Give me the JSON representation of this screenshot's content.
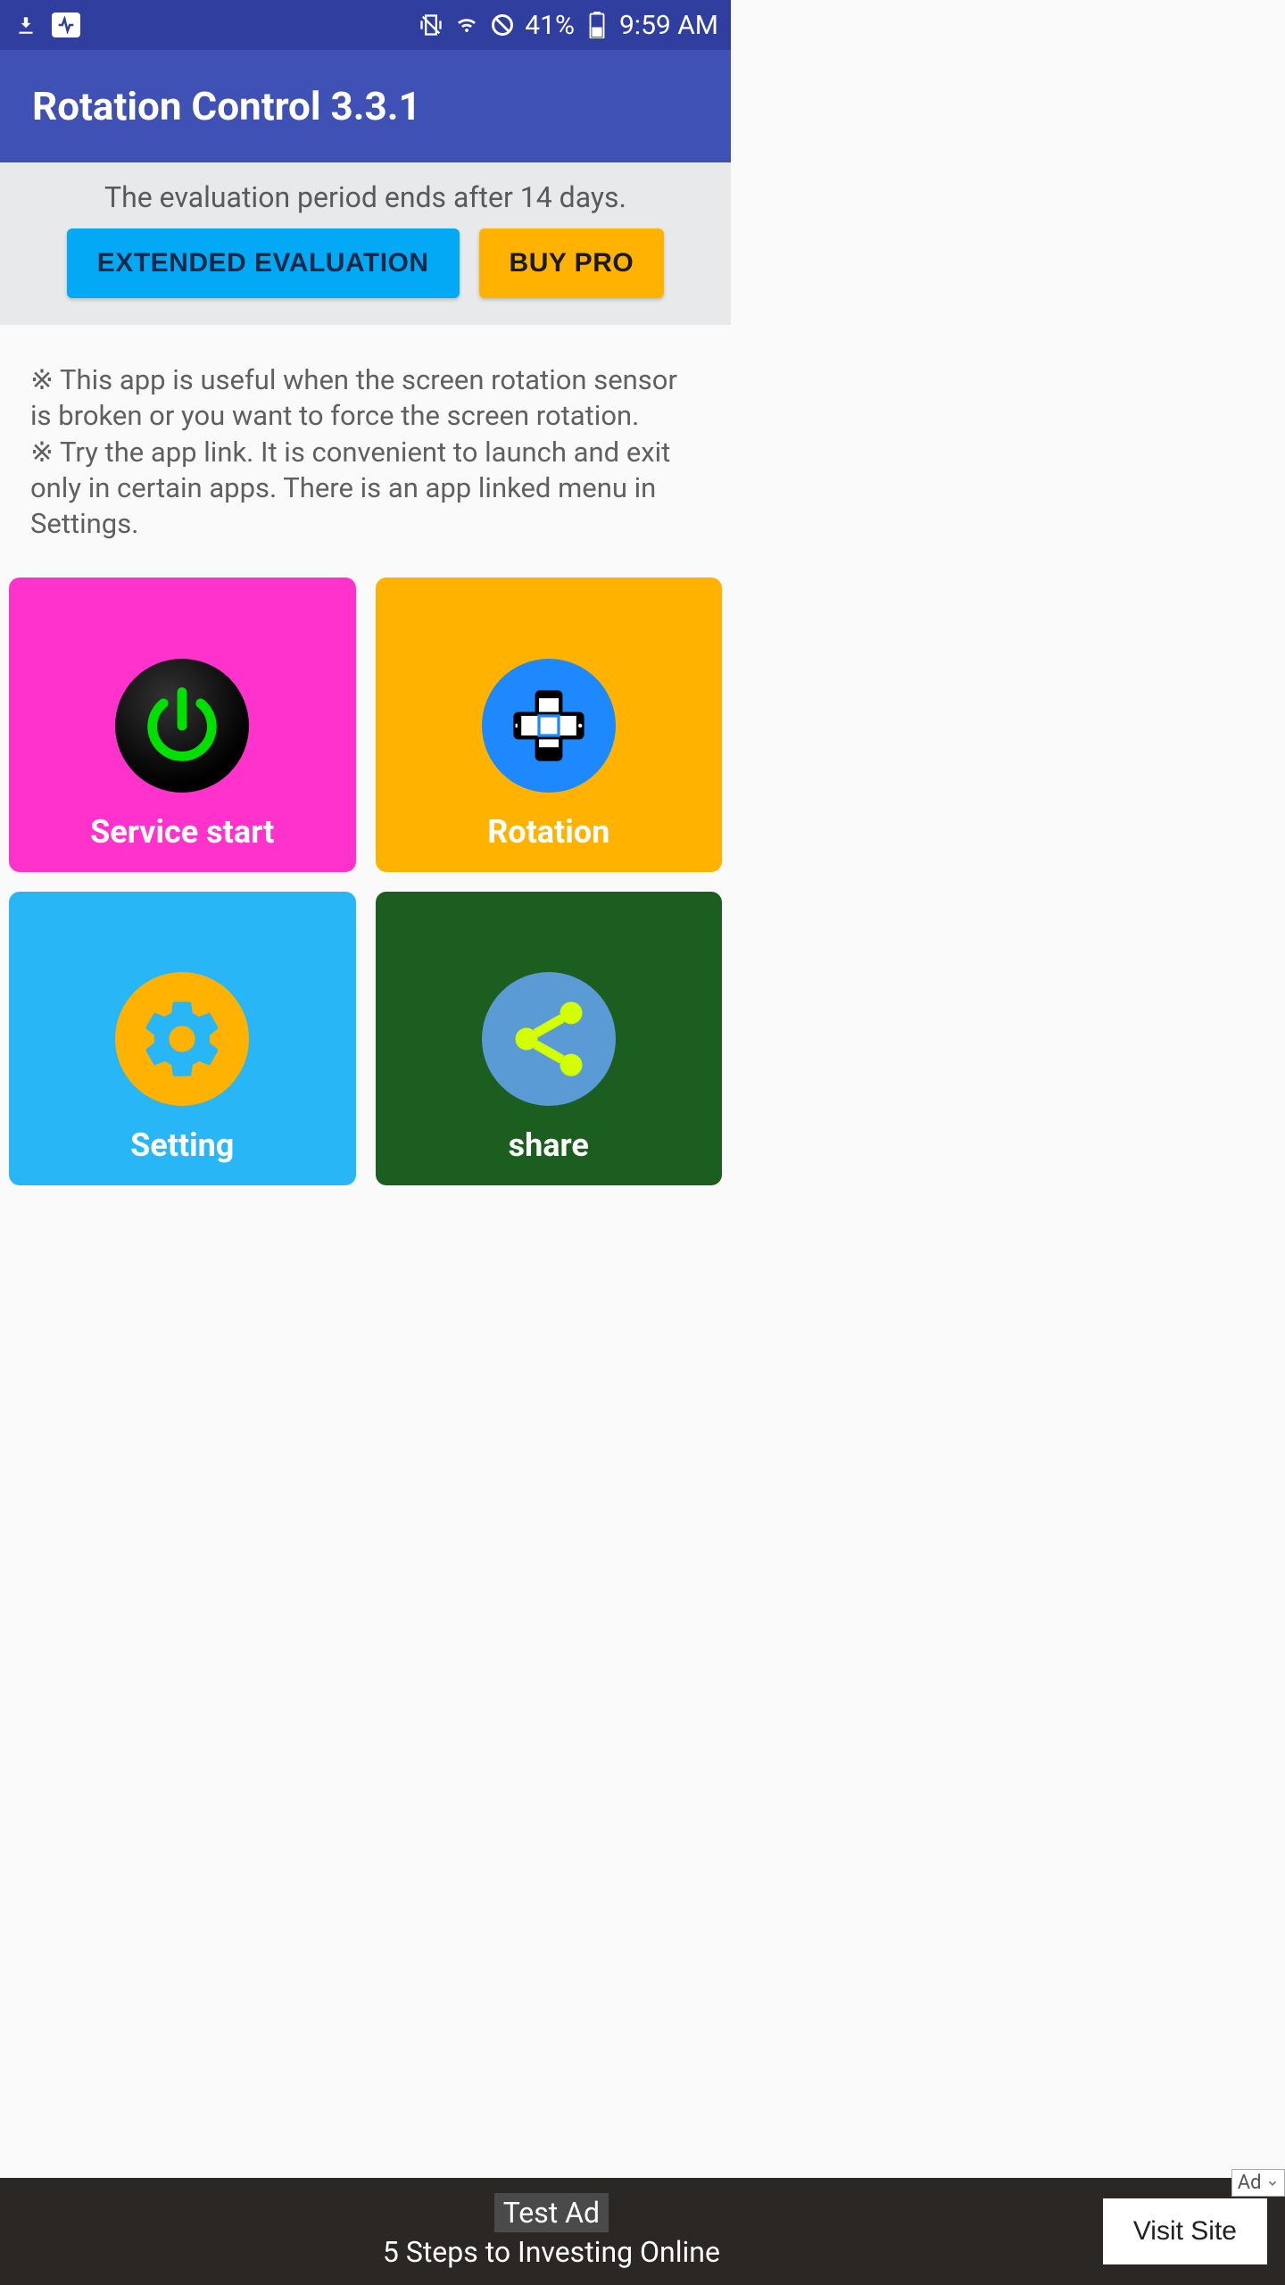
{
  "status": {
    "battery": "41%",
    "time": "9:59 AM"
  },
  "header": {
    "title": "Rotation Control 3.3.1"
  },
  "evaluation": {
    "message": "The evaluation period ends after 14 days.",
    "extend_label": "EXTENDED EVALUATION",
    "buy_label": "BUY PRO"
  },
  "description": {
    "line1": "※ This app is useful when the screen rotation sensor is broken or you want to force the screen rotation.",
    "line2": "※ Try the app link. It is convenient to launch and exit only in certain apps. There is an app linked menu in Settings."
  },
  "tiles": {
    "service_start": "Service start",
    "rotation": "Rotation",
    "setting": "Setting",
    "share": "share"
  },
  "ad": {
    "test": "Test Ad",
    "headline": "5 Steps to Investing Online",
    "cta": "Visit Site",
    "badge": "Ad"
  },
  "colors": {
    "primary": "#3f51b5",
    "primary_dark": "#303f9f",
    "accent_blue": "#03a9f4",
    "accent_orange": "#ffb300",
    "tile_pink": "#ff33cc",
    "tile_orange": "#ffb300",
    "tile_blue": "#29b6f6",
    "tile_green": "#1b5e20"
  }
}
